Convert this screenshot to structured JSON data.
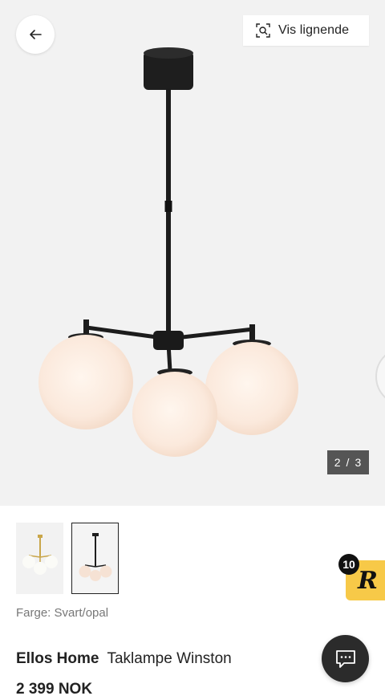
{
  "gallery": {
    "similar_label": "Vis lignende",
    "counter_current": "2",
    "counter_separator": "/",
    "counter_total": "3"
  },
  "product": {
    "color_label": "Farge: Svart/opal",
    "brand": "Ellos Home",
    "name": "Taklampe Winston",
    "price": "2 399 NOK"
  },
  "rewards": {
    "badge_count": "10",
    "logo_letter": "R"
  },
  "icons": {
    "back": "arrow-left-icon",
    "similar": "visual-search-icon",
    "chat": "chat-icon"
  },
  "colors": {
    "hero_bg": "#f2f2f2",
    "counter_bg": "#555555",
    "rewards_yellow": "#f7c948",
    "chat_bg": "#2b2b2b"
  }
}
